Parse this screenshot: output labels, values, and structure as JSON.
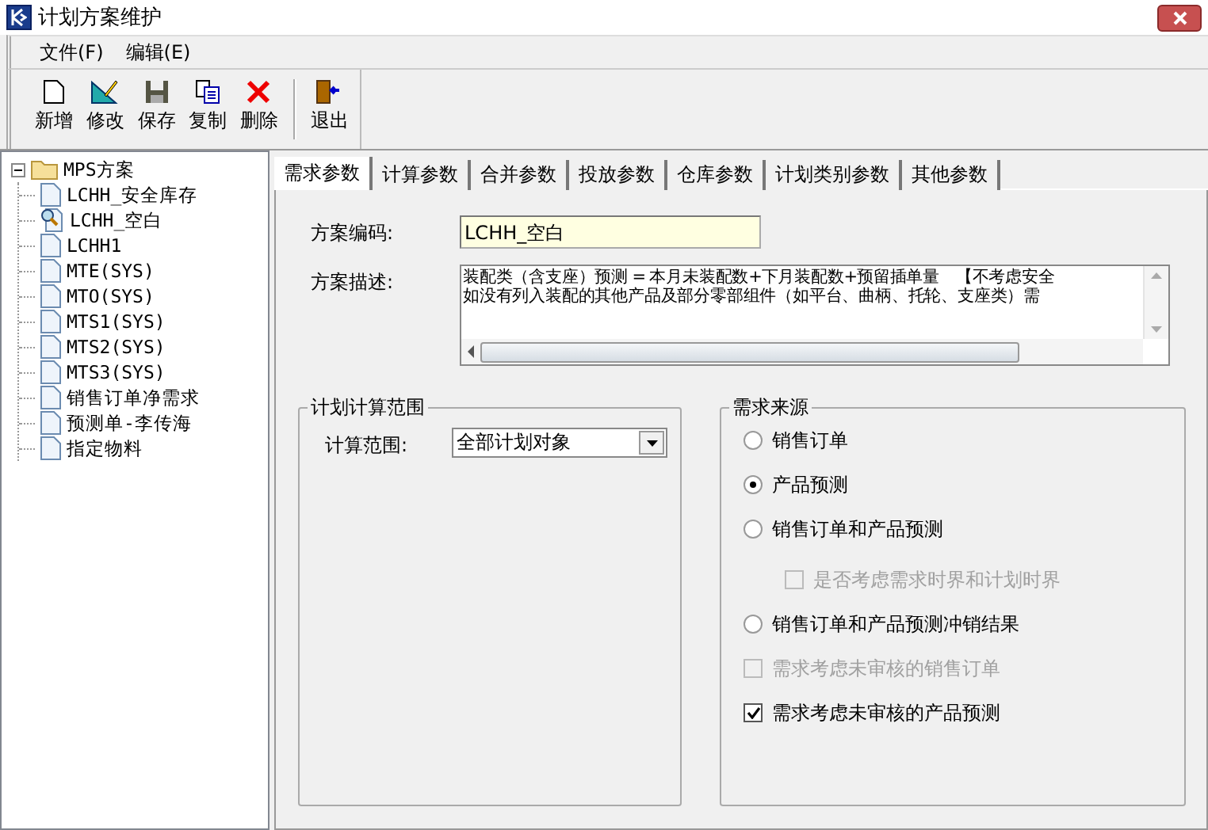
{
  "window": {
    "title": "计划方案维护"
  },
  "menu": [
    "文件(F)",
    "编辑(E)"
  ],
  "toolbar": [
    {
      "label": "新增",
      "kind": "new"
    },
    {
      "label": "修改",
      "kind": "edit"
    },
    {
      "label": "保存",
      "kind": "save"
    },
    {
      "label": "复制",
      "kind": "copy"
    },
    {
      "label": "删除",
      "kind": "delete"
    },
    {
      "label": "退出",
      "kind": "exit"
    }
  ],
  "tree": {
    "label": "MPS方案",
    "expanded": true,
    "children": [
      {
        "label": "LCHH_安全库存",
        "kind": "document"
      },
      {
        "label": "LCHH_空白",
        "kind": "current"
      },
      {
        "label": "LCHH1",
        "kind": "document"
      },
      {
        "label": "MTE(SYS)",
        "kind": "document"
      },
      {
        "label": "MTO(SYS)",
        "kind": "document"
      },
      {
        "label": "MTS1(SYS)",
        "kind": "document"
      },
      {
        "label": "MTS2(SYS)",
        "kind": "document"
      },
      {
        "label": "MTS3(SYS)",
        "kind": "document"
      },
      {
        "label": "销售订单净需求",
        "kind": "document"
      },
      {
        "label": "预测单-李传海",
        "kind": "document"
      },
      {
        "label": "指定物料",
        "kind": "document"
      }
    ]
  },
  "tabs": [
    {
      "label": "需求参数",
      "selected": true
    },
    {
      "label": "计算参数",
      "selected": false
    },
    {
      "label": "合并参数",
      "selected": false
    },
    {
      "label": "投放参数",
      "selected": false
    },
    {
      "label": "仓库参数",
      "selected": false
    },
    {
      "label": "计划类别参数",
      "selected": false
    },
    {
      "label": "其他参数",
      "selected": false
    }
  ],
  "scheme_code": {
    "label": "方案编码:",
    "value": "LCHH_空白"
  },
  "scheme_description": {
    "label": "方案描述:",
    "lines": [
      "装配类（含支座）预测 = 本月未装配数+下月装配数+预留插单量　【不考虑安全",
      "如没有列入装配的其他产品及部分零部组件（如平台、曲柄、托轮、支座类）需"
    ]
  },
  "plan_range": {
    "title": "计划计算范围",
    "label": "计算范围:",
    "value": "全部计划对象"
  },
  "demand_source": {
    "title": "需求来源",
    "options": [
      {
        "kind": "radio",
        "label": "销售订单",
        "selected": false,
        "disabled": false
      },
      {
        "kind": "radio",
        "label": "产品预测",
        "selected": true,
        "disabled": false
      },
      {
        "kind": "radio",
        "label": "销售订单和产品预测",
        "selected": false,
        "disabled": false,
        "children": [
          {
            "kind": "checkbox",
            "label": "是否考虑需求时界和计划时界",
            "checked": false,
            "disabled": true
          }
        ]
      },
      {
        "kind": "radio",
        "label": "销售订单和产品预测冲销结果",
        "selected": false,
        "disabled": false
      },
      {
        "kind": "checkbox",
        "label": "需求考虑未审核的销售订单",
        "checked": false,
        "disabled": true
      },
      {
        "kind": "checkbox",
        "label": "需求考虑未审核的产品预测",
        "checked": true,
        "disabled": false
      }
    ]
  }
}
